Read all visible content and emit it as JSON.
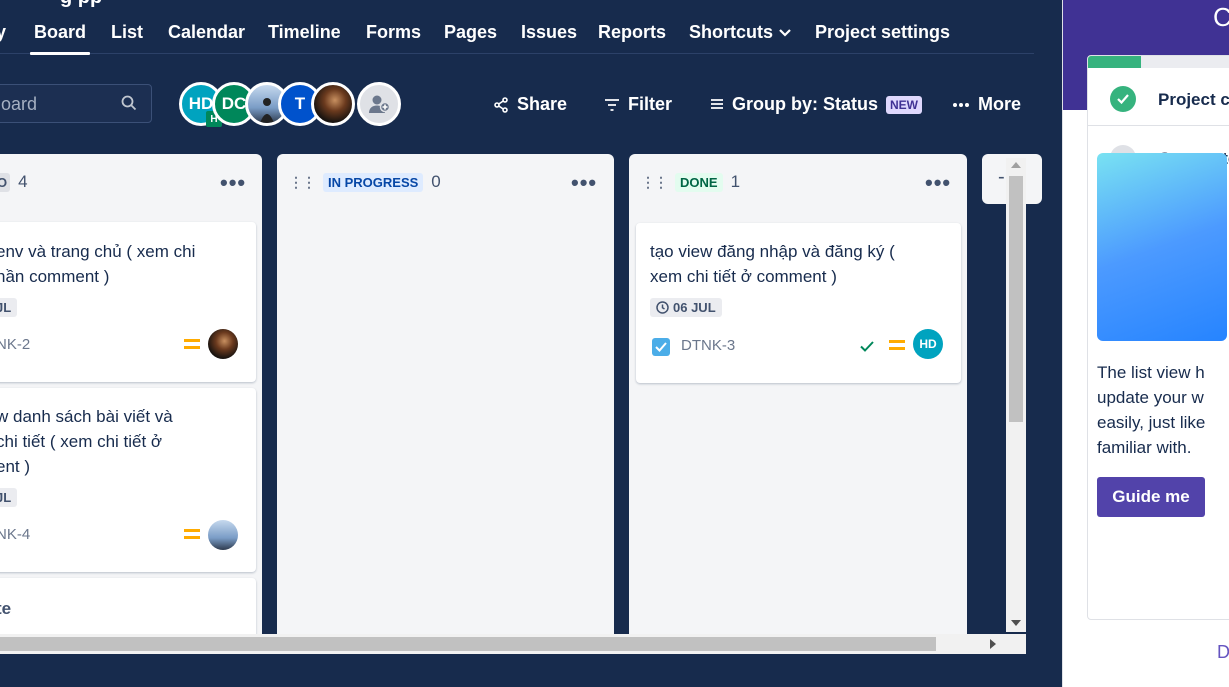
{
  "page": {
    "title_fragment": "g pp"
  },
  "nav": {
    "items": [
      {
        "label": "y"
      },
      {
        "label": "Board"
      },
      {
        "label": "List"
      },
      {
        "label": "Calendar"
      },
      {
        "label": "Timeline"
      },
      {
        "label": "Forms"
      },
      {
        "label": "Pages"
      },
      {
        "label": "Issues"
      },
      {
        "label": "Reports"
      },
      {
        "label": "Shortcuts"
      },
      {
        "label": "Project settings"
      }
    ],
    "active": "Board"
  },
  "toolbar": {
    "search_placeholder": "oard",
    "avatars": [
      {
        "initials": "HD",
        "color": "#00a3bf",
        "badge": "H"
      },
      {
        "initials": "DC",
        "color": "#00875a"
      },
      {
        "initials": "",
        "color": "#7a9cc6"
      },
      {
        "initials": "T",
        "color": "#0052cc"
      },
      {
        "initials": "",
        "color": "#3a2a1a"
      }
    ],
    "share": "Share",
    "filter": "Filter",
    "group_by": "Group by: Status",
    "new_badge": "NEW",
    "more": "More"
  },
  "board": {
    "columns": [
      {
        "status": "O",
        "count": "4",
        "cards": [
          {
            "title_line1": "env và trang chủ ( xem chi",
            "title_line2": "hần comment )",
            "date": "JL",
            "key": "NK-2"
          },
          {
            "title_line1": "w danh sách bài viết và",
            "title_line2": " chi tiết ( xem chi tiết ở",
            "title_line3": "ent )",
            "date": "JL",
            "key": "NK-4"
          }
        ],
        "footer": "te"
      },
      {
        "status": "IN PROGRESS",
        "count": "0",
        "cards": []
      },
      {
        "status": "DONE",
        "count": "1",
        "cards": [
          {
            "title_line1": "tạo view đăng nhập và đăng ký (",
            "title_line2": "xem chi tiết ở comment )",
            "date": "06 JUL",
            "key": "DTNK-3",
            "assignee": "HD"
          }
        ]
      },
      {
        "status": "",
        "count": "-",
        "cards": []
      }
    ]
  },
  "sidepanel": {
    "header_fragment": "C",
    "progress": 0.33,
    "steps": [
      {
        "label": "Project cr",
        "done": true
      },
      {
        "label": "Get starte",
        "done": false
      }
    ],
    "description": "The list view h\nupdate your w\neasily, just like\nfamiliar with.",
    "guide_button": "Guide me",
    "footer_fragment": "D"
  },
  "colors": {
    "accent": "#5243aa",
    "brand": "#172b4d",
    "done": "#36b37e",
    "in_progress_bg": "#deebff",
    "done_bg": "#e3fcef"
  }
}
